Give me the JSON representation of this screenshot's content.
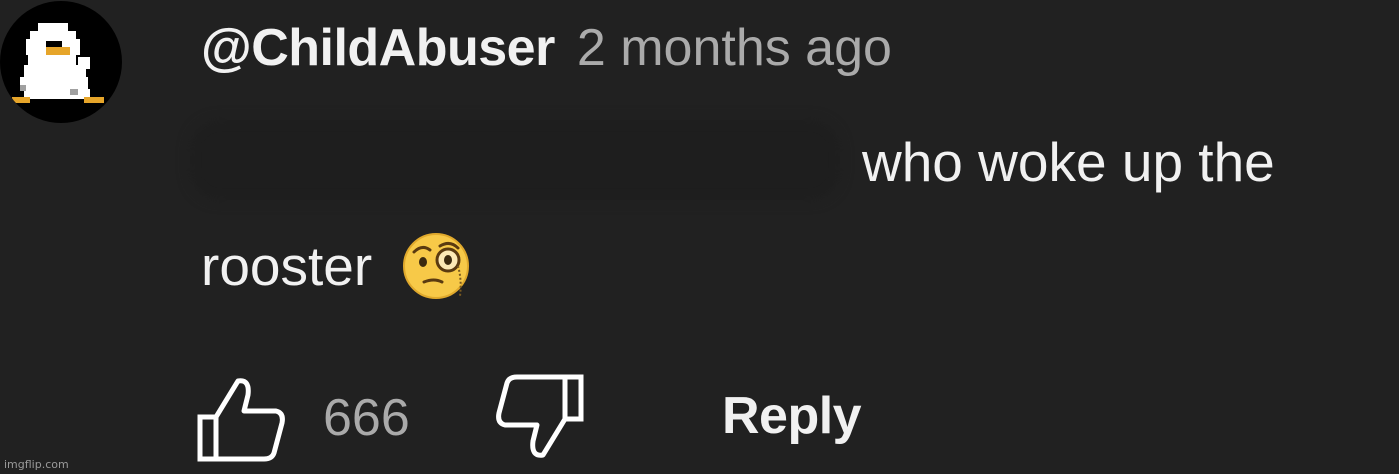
{
  "comment": {
    "author": "@ChildAbuser",
    "time": "2 months ago",
    "text_line1": "who woke up the",
    "text_line2": "rooster",
    "emoji_icon": "face-with-monocle-icon",
    "avatar_icon": "pixel-duck-avatar-icon"
  },
  "actions": {
    "like_icon": "thumbs-up-icon",
    "like_count": "666",
    "dislike_icon": "thumbs-down-icon",
    "reply_label": "Reply"
  },
  "watermark": "imgflip.com",
  "colors": {
    "background": "#212121",
    "text_primary": "#f1f1f1",
    "text_secondary": "#aaaaaa"
  }
}
